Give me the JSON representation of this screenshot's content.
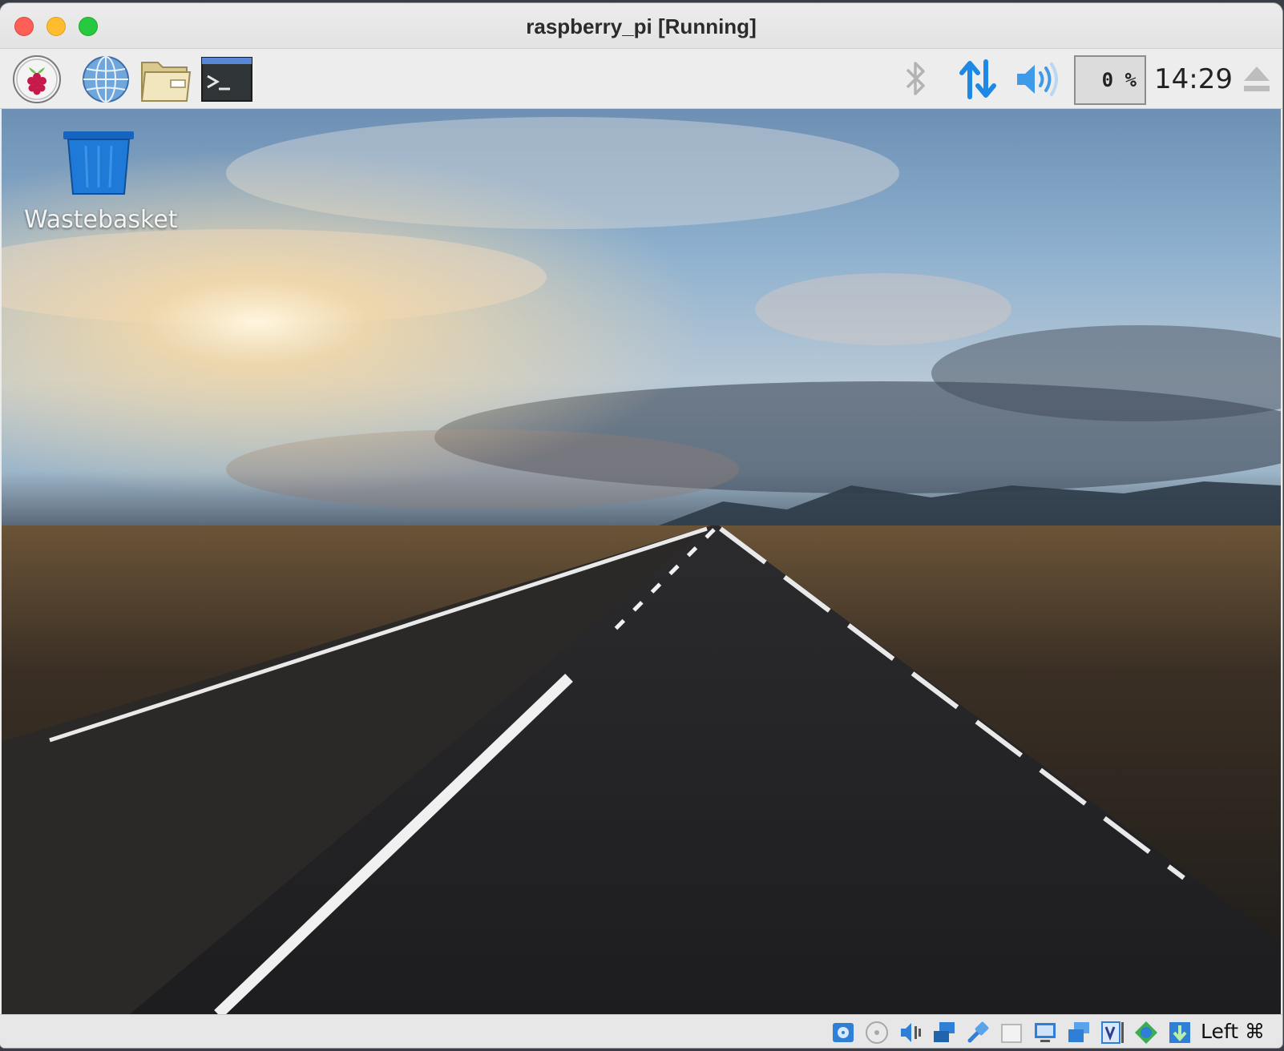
{
  "window": {
    "title": "raspberry_pi [Running]"
  },
  "panel": {
    "launchers": [
      {
        "name": "raspberry-menu-icon"
      },
      {
        "name": "web-browser-icon"
      },
      {
        "name": "file-manager-icon"
      },
      {
        "name": "terminal-icon"
      }
    ],
    "cpu_usage": "0 %",
    "clock": "14:29"
  },
  "desktop": {
    "icons": [
      {
        "label": "Wastebasket",
        "icon": "trash-icon"
      }
    ]
  },
  "statusbar": {
    "host_key": "Left ⌘"
  },
  "colors": {
    "accent_blue": "#1e88e5",
    "raspberry_red": "#c51a4a"
  }
}
